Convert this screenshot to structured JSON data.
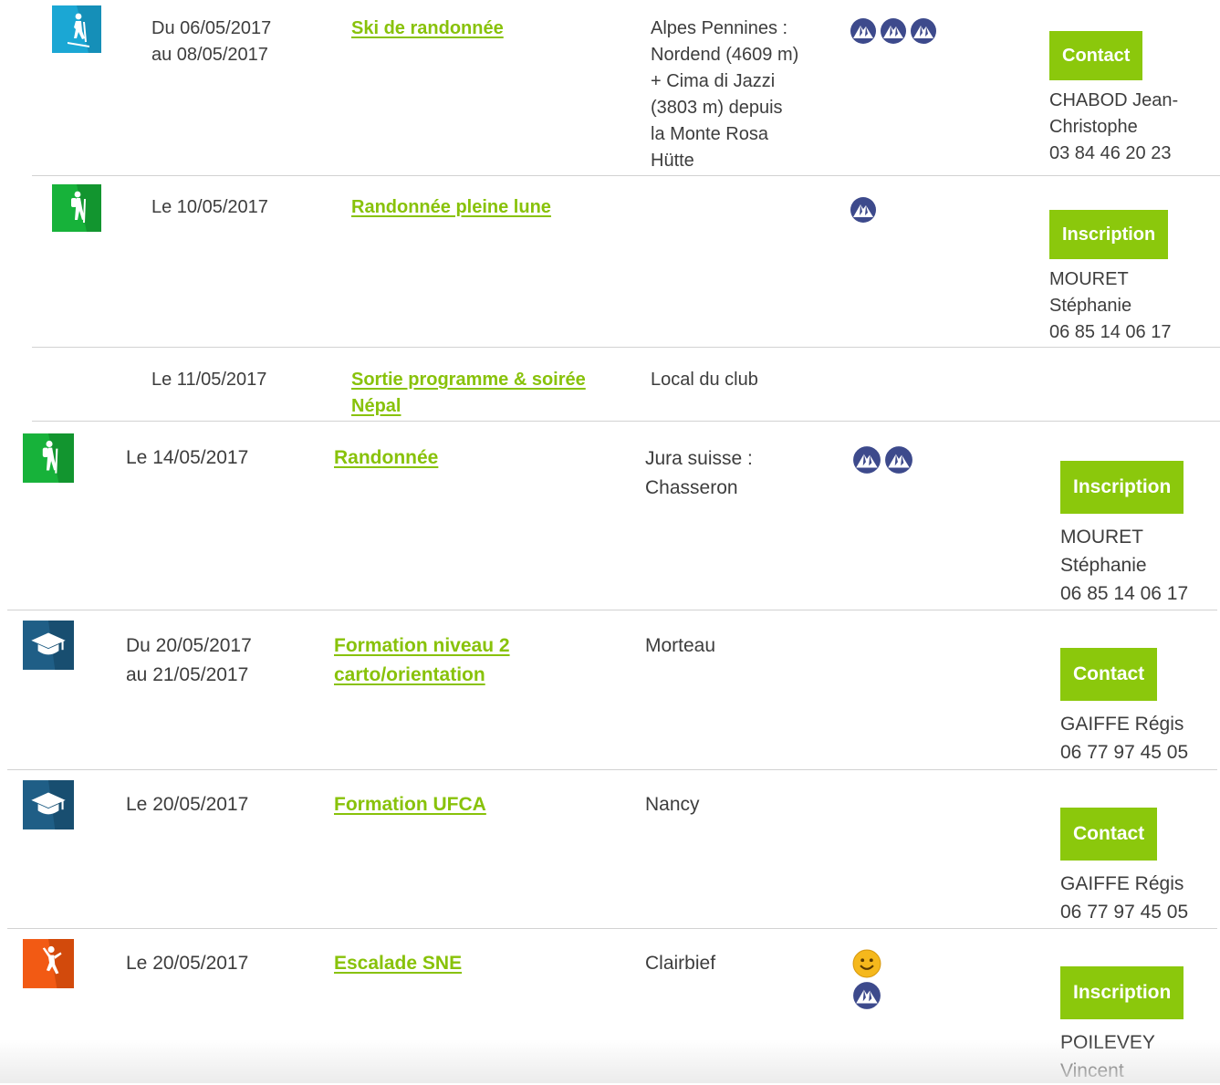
{
  "colors": {
    "accent": "#8bc80c",
    "link": "#88c20a",
    "ski_icon": "#1ba7d4",
    "hike_icon": "#17b23a",
    "formation_icon": "#1f5e86",
    "climb_icon": "#f25a14",
    "level_icon": "#3d4a8c",
    "smiley": "#f5b81c"
  },
  "outings": [
    {
      "icon": "ski-touring-icon",
      "date_line1": "Du 06/05/2017",
      "date_line2": "au 08/05/2017",
      "title_line1": "Ski de randonnée",
      "title_line2": "",
      "place_lines": [
        "Alpes Pennines :",
        "Nordend (4609 m)",
        "+ Cima di Jazzi",
        "(3803 m) depuis",
        "la Monte Rosa",
        "Hütte"
      ],
      "level": 3,
      "button": "Contact",
      "contact_lines": [
        "CHABOD Jean-",
        "Christophe",
        "03 84 46 20 23"
      ]
    },
    {
      "icon": "hiking-icon",
      "date_line1": "Le 10/05/2017",
      "date_line2": "",
      "title_line1": "Randonnée pleine lune",
      "title_line2": "",
      "place_lines": [],
      "level": 1,
      "button": "Inscription",
      "contact_lines": [
        "MOURET",
        "Stéphanie",
        "06 85 14 06 17"
      ]
    },
    {
      "icon": "",
      "date_line1": "Le 11/05/2017",
      "date_line2": "",
      "title_line1": "Sortie programme & soirée",
      "title_line2": "Népal",
      "place_lines": [
        "Local du club"
      ],
      "level": 0,
      "button": "",
      "contact_lines": []
    },
    {
      "icon": "hiking-icon",
      "date_line1": "Le 14/05/2017",
      "date_line2": "",
      "title_line1": "Randonnée",
      "title_line2": "",
      "place_lines": [
        "Jura suisse :",
        "Chasseron"
      ],
      "level": 2,
      "button": "Inscription",
      "contact_lines": [
        "MOURET",
        "Stéphanie",
        "06 85 14 06 17"
      ]
    },
    {
      "icon": "graduation-cap-icon",
      "date_line1": "Du 20/05/2017",
      "date_line2": "au 21/05/2017",
      "title_line1": "Formation niveau 2",
      "title_line2": "carto/orientation",
      "place_lines": [
        "Morteau"
      ],
      "level": 0,
      "button": "Contact",
      "contact_lines": [
        "GAIFFE Régis",
        "06 77 97 45 05"
      ]
    },
    {
      "icon": "graduation-cap-icon",
      "date_line1": "Le 20/05/2017",
      "date_line2": "",
      "title_line1": "Formation UFCA",
      "title_line2": "",
      "place_lines": [
        "Nancy"
      ],
      "level": 0,
      "button": "Contact",
      "contact_lines": [
        "GAIFFE Régis",
        "06 77 97 45 05"
      ]
    },
    {
      "icon": "climbing-icon",
      "date_line1": "Le 20/05/2017",
      "date_line2": "",
      "title_line1": "Escalade SNE",
      "title_line2": "",
      "place_lines": [
        "Clairbief"
      ],
      "level": 1,
      "extra_badge": "smiley-icon",
      "button": "Inscription",
      "contact_lines": [
        "POILEVEY",
        "Vincent"
      ]
    }
  ]
}
